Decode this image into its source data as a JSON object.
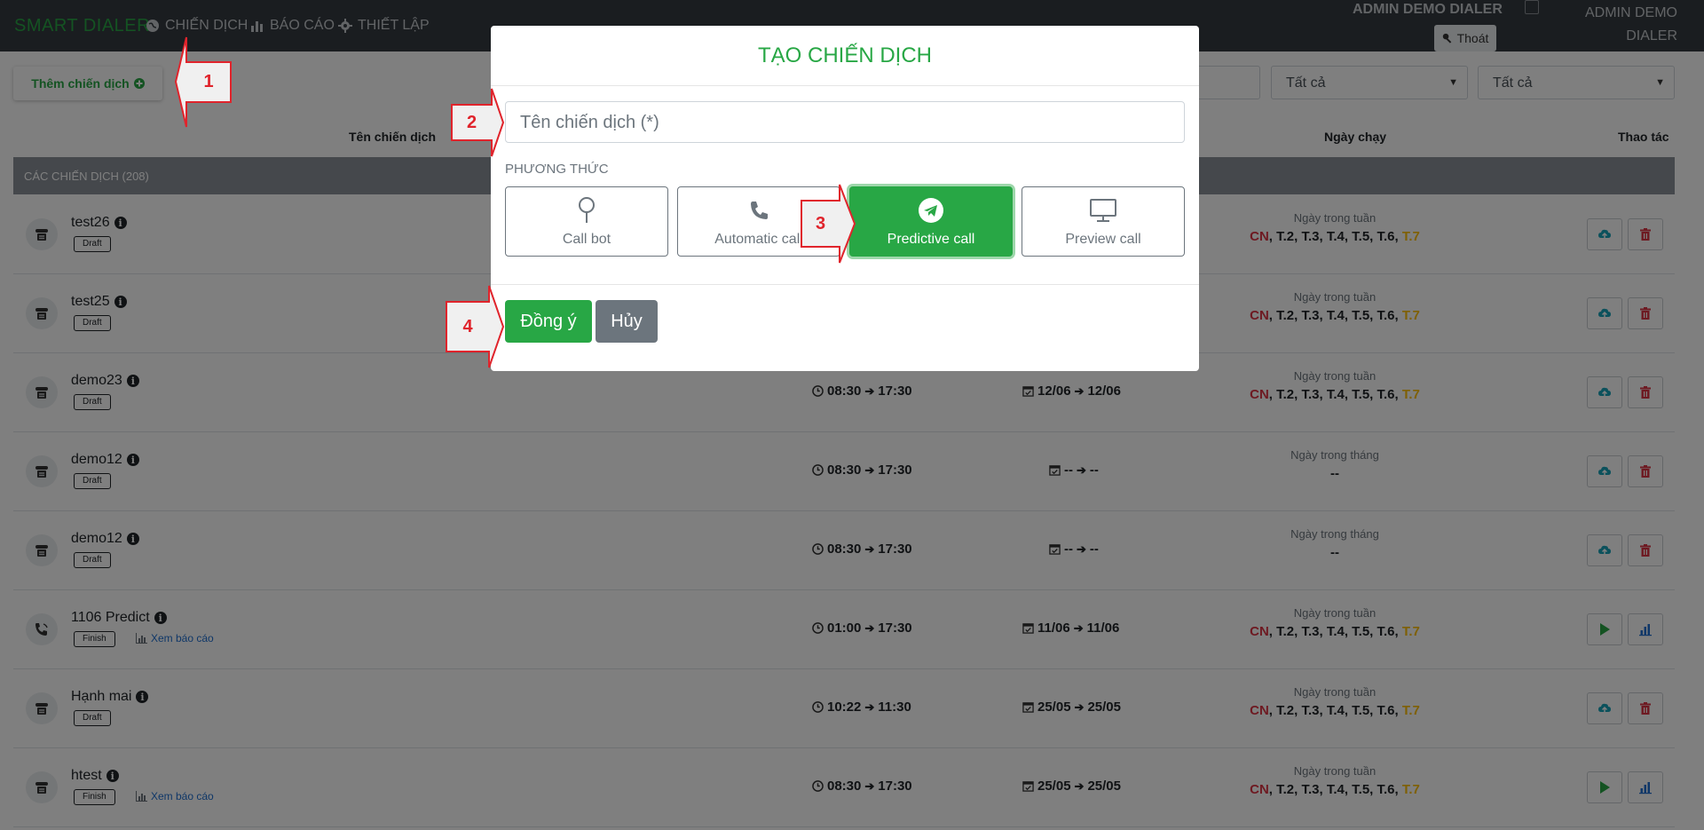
{
  "navbar": {
    "brand": "SMART DIALER",
    "nav": [
      "CHIẾN DỊCH",
      "BÁO CÁO",
      "THIẾT LẬP"
    ],
    "user_name": "ADMIN DEMO DIALER",
    "user_name_2": "ADMIN DEMO DIALER",
    "logout_label": "Thoát"
  },
  "toolbar": {
    "add_label": "Thêm chiến dịch",
    "filter_1": "Tất cả",
    "filter_2": "Tất cả"
  },
  "table": {
    "headers": {
      "name": "Tên chiến dịch",
      "run_date": "Ngày chạy",
      "actions": "Thao tác"
    },
    "section_title": "CÁC CHIẾN DỊCH (208)",
    "rows": [
      {
        "name": "test26",
        "status": "Draft",
        "time_start": "",
        "time_end": "",
        "date_start": "",
        "date_end": "",
        "days_label": "Ngày trong tuần",
        "days_mode": "week",
        "days_val": "--"
      },
      {
        "name": "test25",
        "status": "Draft",
        "time_start": "",
        "time_end": "",
        "date_start": "",
        "date_end": "",
        "days_label": "Ngày trong tuần",
        "days_mode": "week",
        "days_val": "--"
      },
      {
        "name": "demo23",
        "status": "Draft",
        "time_start": "08:30",
        "time_end": "17:30",
        "date_start": "12/06",
        "date_end": "12/06",
        "days_label": "Ngày trong tuần",
        "days_mode": "week",
        "days_val": "--"
      },
      {
        "name": "demo12",
        "status": "Draft",
        "time_start": "08:30",
        "time_end": "17:30",
        "date_start": "--",
        "date_end": "--",
        "days_label": "Ngày trong tháng",
        "days_mode": "month",
        "days_val": "--"
      },
      {
        "name": "demo12",
        "status": "Draft",
        "time_start": "08:30",
        "time_end": "17:30",
        "date_start": "--",
        "date_end": "--",
        "days_label": "Ngày trong tháng",
        "days_mode": "month",
        "days_val": "--"
      },
      {
        "name": "1106 Predict",
        "status": "Finish",
        "report": "Xem báo cáo",
        "time_start": "01:00",
        "time_end": "17:30",
        "date_start": "11/06",
        "date_end": "11/06",
        "days_label": "Ngày trong tuần",
        "days_mode": "week",
        "days_val": "--"
      },
      {
        "name": "Hạnh mai",
        "status": "Draft",
        "time_start": "10:22",
        "time_end": "11:30",
        "date_start": "25/05",
        "date_end": "25/05",
        "days_label": "Ngày trong tuần",
        "days_mode": "week",
        "days_val": "--"
      },
      {
        "name": "htest",
        "status": "Finish",
        "report": "Xem báo cáo",
        "time_start": "08:30",
        "time_end": "17:30",
        "date_start": "25/05",
        "date_end": "25/05",
        "days_label": "Ngày trong tuần",
        "days_mode": "week",
        "days_val": "--"
      }
    ],
    "week_days": {
      "cn": "CN",
      "mid": ", T.2, T.3, T.4, T.5, T.6, ",
      "t7": "T.7"
    }
  },
  "modal": {
    "title": "TẠO CHIẾN DỊCH",
    "name_placeholder": "Tên chiến dịch (*)",
    "method_label": "PHƯƠNG THỨC",
    "methods": [
      {
        "label": "Call bot",
        "icon": "map-pin-icon"
      },
      {
        "label": "Automatic call",
        "icon": "phone-icon"
      },
      {
        "label": "Predictive call",
        "icon": "telegram-icon"
      },
      {
        "label": "Preview call",
        "icon": "monitor-icon"
      }
    ],
    "selected_method": "Predictive call",
    "ok_label": "Đồng ý",
    "cancel_label": "Hủy"
  },
  "callouts": [
    "1",
    "2",
    "3",
    "4"
  ],
  "colors": {
    "accent": "#28a745",
    "danger": "#dc3545",
    "warning": "#ffc107",
    "callout": "#e0242c"
  }
}
